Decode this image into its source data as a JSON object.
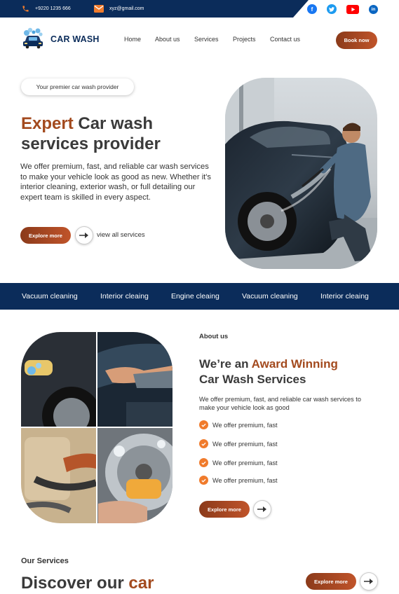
{
  "topbar": {
    "phone": "+9220 1235 666",
    "email": "xyz@gmail.com",
    "socials": [
      "facebook-icon",
      "twitter-icon",
      "youtube-icon",
      "linkedin-icon"
    ]
  },
  "header": {
    "brand": "CAR WASH",
    "nav": [
      "Home",
      "About us",
      "Services",
      "Projects",
      "Contact us"
    ],
    "cta": "Book now"
  },
  "hero": {
    "pill": "Your premier car wash provider",
    "title_accent": "Expert",
    "title_rest_1": " Car wash",
    "title_line_2": "services provider",
    "description": "We offer premium, fast, and reliable car wash services to make your vehicle look as good as new. Whether it's interior cleaning, exterior wash, or full detailing our expert team is skilled in every aspect.",
    "explore_label": "Explore more",
    "view_all_label": "view all services"
  },
  "band": {
    "items": [
      "Vacuum cleaning",
      "Interior cleaing",
      "Engine cleaing",
      "Vacuum cleaning",
      "Interior cleaing"
    ]
  },
  "about": {
    "label": "About us",
    "title_pre": "We’re an ",
    "title_accent": "Award Winning",
    "title_line_2": "Car Wash Services",
    "description": "We offer premium, fast, and reliable car wash services to make your vehicle look as good",
    "checks": [
      "We offer premium, fast",
      "We offer premium, fast",
      "We offer premium, fast",
      "We offer premium, fast"
    ],
    "explore_label": "Explore more"
  },
  "our_services": {
    "label": "Our Services",
    "title_pre": "Discover our ",
    "title_accent": "car",
    "explore_label": "Explore more"
  },
  "colors": {
    "navy": "#0b2c5a",
    "accent_brown": "#a34a1e",
    "button_gradient_start": "#8b3a1a",
    "button_gradient_end": "#c0542a",
    "check_orange": "#f07b2c"
  }
}
